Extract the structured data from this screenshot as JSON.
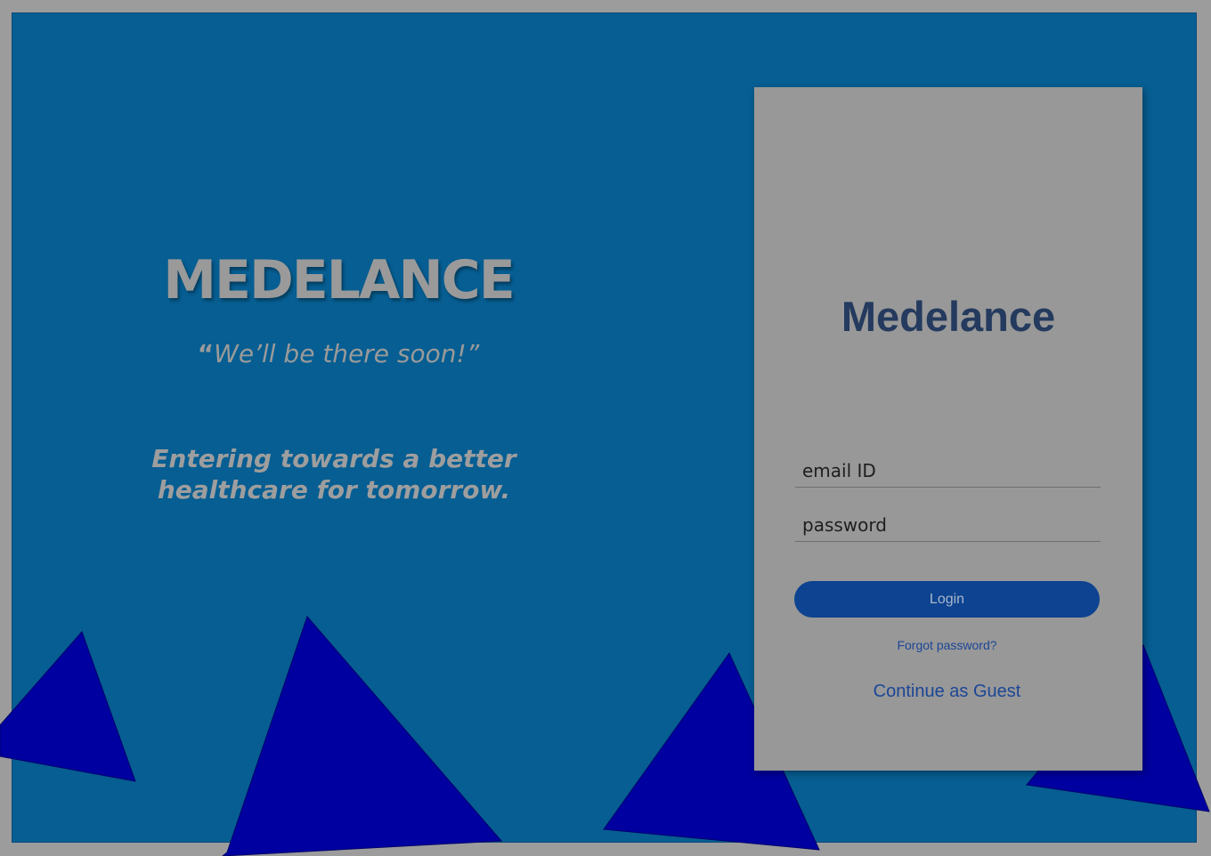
{
  "hero": {
    "brand": "MEDELANCE",
    "tagline_quote": "“",
    "tagline": "We’ll be there soon!”",
    "mission_line1": "Entering towards a better",
    "mission_line2": "healthcare for tomorrow."
  },
  "login_card": {
    "title": "Medelance",
    "email_placeholder": "email ID",
    "password_placeholder": "password",
    "login_label": "Login",
    "forgot_label": "Forgot password?",
    "guest_label": "Continue as Guest"
  },
  "colors": {
    "background": "#065e92",
    "page_border": "#9c9c9c",
    "card": "#989898",
    "triangle": "#0000a0",
    "button": "#0d4390",
    "link": "#1c4696",
    "card_title": "#243a5e"
  }
}
